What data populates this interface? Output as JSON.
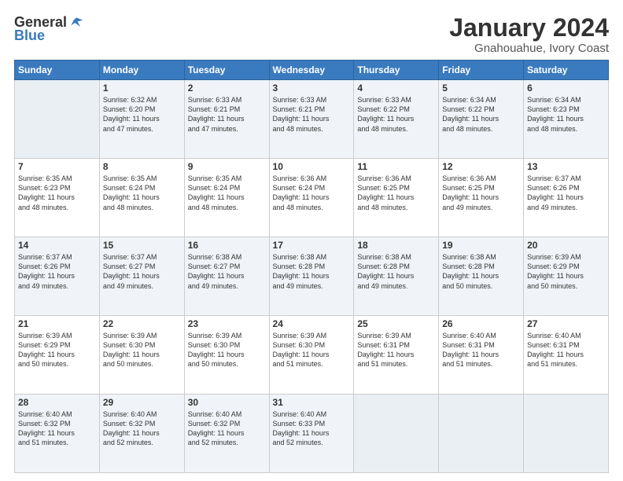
{
  "header": {
    "logo_general": "General",
    "logo_blue": "Blue",
    "title": "January 2024",
    "subtitle": "Gnahouahue, Ivory Coast"
  },
  "days_of_week": [
    "Sunday",
    "Monday",
    "Tuesday",
    "Wednesday",
    "Thursday",
    "Friday",
    "Saturday"
  ],
  "weeks": [
    [
      {
        "day": "",
        "data": ""
      },
      {
        "day": "1",
        "data": "Sunrise: 6:32 AM\nSunset: 6:20 PM\nDaylight: 11 hours\nand 47 minutes."
      },
      {
        "day": "2",
        "data": "Sunrise: 6:33 AM\nSunset: 6:21 PM\nDaylight: 11 hours\nand 47 minutes."
      },
      {
        "day": "3",
        "data": "Sunrise: 6:33 AM\nSunset: 6:21 PM\nDaylight: 11 hours\nand 48 minutes."
      },
      {
        "day": "4",
        "data": "Sunrise: 6:33 AM\nSunset: 6:22 PM\nDaylight: 11 hours\nand 48 minutes."
      },
      {
        "day": "5",
        "data": "Sunrise: 6:34 AM\nSunset: 6:22 PM\nDaylight: 11 hours\nand 48 minutes."
      },
      {
        "day": "6",
        "data": "Sunrise: 6:34 AM\nSunset: 6:23 PM\nDaylight: 11 hours\nand 48 minutes."
      }
    ],
    [
      {
        "day": "7",
        "data": "Sunrise: 6:35 AM\nSunset: 6:23 PM\nDaylight: 11 hours\nand 48 minutes."
      },
      {
        "day": "8",
        "data": "Sunrise: 6:35 AM\nSunset: 6:24 PM\nDaylight: 11 hours\nand 48 minutes."
      },
      {
        "day": "9",
        "data": "Sunrise: 6:35 AM\nSunset: 6:24 PM\nDaylight: 11 hours\nand 48 minutes."
      },
      {
        "day": "10",
        "data": "Sunrise: 6:36 AM\nSunset: 6:24 PM\nDaylight: 11 hours\nand 48 minutes."
      },
      {
        "day": "11",
        "data": "Sunrise: 6:36 AM\nSunset: 6:25 PM\nDaylight: 11 hours\nand 48 minutes."
      },
      {
        "day": "12",
        "data": "Sunrise: 6:36 AM\nSunset: 6:25 PM\nDaylight: 11 hours\nand 49 minutes."
      },
      {
        "day": "13",
        "data": "Sunrise: 6:37 AM\nSunset: 6:26 PM\nDaylight: 11 hours\nand 49 minutes."
      }
    ],
    [
      {
        "day": "14",
        "data": "Sunrise: 6:37 AM\nSunset: 6:26 PM\nDaylight: 11 hours\nand 49 minutes."
      },
      {
        "day": "15",
        "data": "Sunrise: 6:37 AM\nSunset: 6:27 PM\nDaylight: 11 hours\nand 49 minutes."
      },
      {
        "day": "16",
        "data": "Sunrise: 6:38 AM\nSunset: 6:27 PM\nDaylight: 11 hours\nand 49 minutes."
      },
      {
        "day": "17",
        "data": "Sunrise: 6:38 AM\nSunset: 6:28 PM\nDaylight: 11 hours\nand 49 minutes."
      },
      {
        "day": "18",
        "data": "Sunrise: 6:38 AM\nSunset: 6:28 PM\nDaylight: 11 hours\nand 49 minutes."
      },
      {
        "day": "19",
        "data": "Sunrise: 6:38 AM\nSunset: 6:28 PM\nDaylight: 11 hours\nand 50 minutes."
      },
      {
        "day": "20",
        "data": "Sunrise: 6:39 AM\nSunset: 6:29 PM\nDaylight: 11 hours\nand 50 minutes."
      }
    ],
    [
      {
        "day": "21",
        "data": "Sunrise: 6:39 AM\nSunset: 6:29 PM\nDaylight: 11 hours\nand 50 minutes."
      },
      {
        "day": "22",
        "data": "Sunrise: 6:39 AM\nSunset: 6:30 PM\nDaylight: 11 hours\nand 50 minutes."
      },
      {
        "day": "23",
        "data": "Sunrise: 6:39 AM\nSunset: 6:30 PM\nDaylight: 11 hours\nand 50 minutes."
      },
      {
        "day": "24",
        "data": "Sunrise: 6:39 AM\nSunset: 6:30 PM\nDaylight: 11 hours\nand 51 minutes."
      },
      {
        "day": "25",
        "data": "Sunrise: 6:39 AM\nSunset: 6:31 PM\nDaylight: 11 hours\nand 51 minutes."
      },
      {
        "day": "26",
        "data": "Sunrise: 6:40 AM\nSunset: 6:31 PM\nDaylight: 11 hours\nand 51 minutes."
      },
      {
        "day": "27",
        "data": "Sunrise: 6:40 AM\nSunset: 6:31 PM\nDaylight: 11 hours\nand 51 minutes."
      }
    ],
    [
      {
        "day": "28",
        "data": "Sunrise: 6:40 AM\nSunset: 6:32 PM\nDaylight: 11 hours\nand 51 minutes."
      },
      {
        "day": "29",
        "data": "Sunrise: 6:40 AM\nSunset: 6:32 PM\nDaylight: 11 hours\nand 52 minutes."
      },
      {
        "day": "30",
        "data": "Sunrise: 6:40 AM\nSunset: 6:32 PM\nDaylight: 11 hours\nand 52 minutes."
      },
      {
        "day": "31",
        "data": "Sunrise: 6:40 AM\nSunset: 6:33 PM\nDaylight: 11 hours\nand 52 minutes."
      },
      {
        "day": "",
        "data": ""
      },
      {
        "day": "",
        "data": ""
      },
      {
        "day": "",
        "data": ""
      }
    ]
  ]
}
